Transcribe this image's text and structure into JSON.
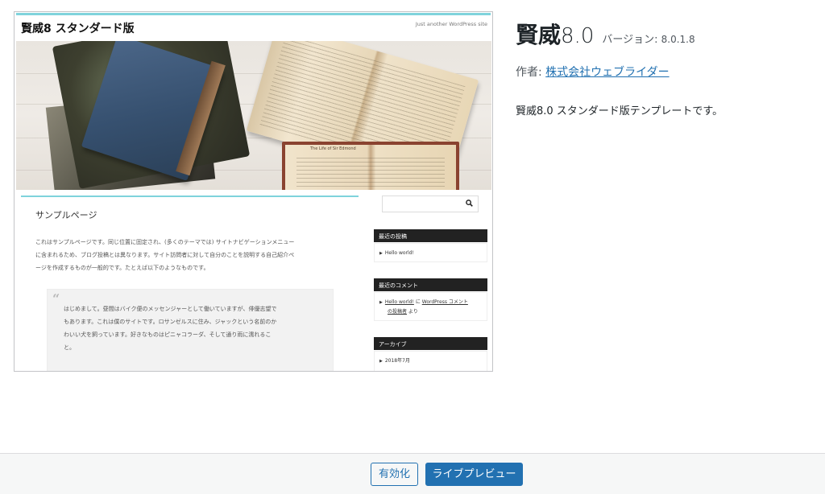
{
  "screenshot": {
    "site_title": "賢威8 スタンダード版",
    "tagline": "Just another WordPress site",
    "hero_caption": "The Life of Sir Edmond",
    "page": {
      "title": "サンプルページ",
      "body_lines": [
        "これはサンプルページです。同じ位置に固定され、(多くのテーマでは) サイトナビゲーションメニュー",
        "に含まれるため、ブログ投稿とは異なります。サイト訪問者に対して自分のことを説明する自己紹介ペ",
        "ージを作成するものが一般的です。たとえば以下のようなものです。"
      ],
      "quote_mark": "“",
      "quote_lines": [
        "はじめまして。昼間はバイク便のメッセンジャーとして働いていますが、俳優志望で",
        "もあります。これは僕のサイトです。ロサンゼルスに住み、ジャックという名前のか",
        "わいい犬を飼っています。好きなものはピニャコラーダ、そして通り雨に濡れるこ",
        "と。"
      ]
    },
    "sidebar": {
      "search_icon": "search-icon",
      "recent_posts_heading": "最近の投稿",
      "recent_post": "Hello world!",
      "recent_comments_heading": "最近のコメント",
      "comment_post_link": "Hello world!",
      "comment_connector": " に ",
      "comment_author_link": "WordPress コメント",
      "comment_author_link_line2": "の投稿者",
      "comment_suffix": " より",
      "archives_heading": "アーカイブ",
      "archive_item": "2018年7月"
    }
  },
  "theme": {
    "name": "賢威",
    "version_display": "8.0",
    "version_label": "バージョン: ",
    "version": "8.0.1.8",
    "author_label": "作者: ",
    "author": "株式会社ウェブライダー",
    "description": "賢威8.0 スタンダード版テンプレートです。"
  },
  "actions": {
    "activate": "有効化",
    "live_preview": "ライブプレビュー"
  },
  "colors": {
    "accent": "#2271b1",
    "theme_accent": "#7fd3dc",
    "sidebar_heading_bg": "#222222"
  }
}
